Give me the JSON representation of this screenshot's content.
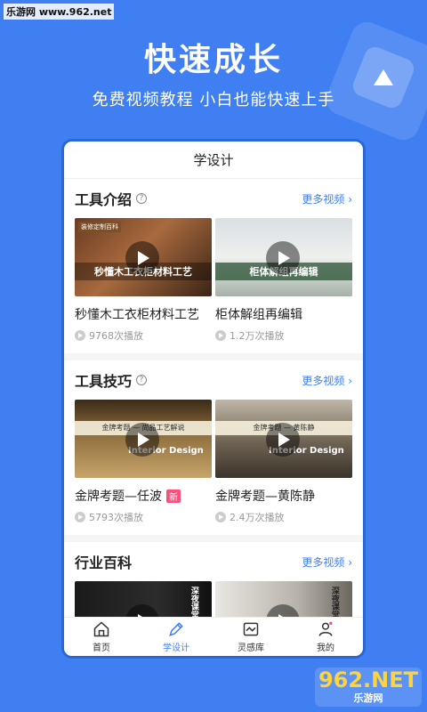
{
  "watermark_top": "乐游网 www.962.net",
  "headline": "快速成长",
  "subline": "免费视频教程 小白也能快速上手",
  "phone_title": "学设计",
  "sections": [
    {
      "title": "工具介绍",
      "help": "?",
      "more": "更多视频 ›",
      "cards": [
        {
          "title": "秒懂木工衣柜材料工艺",
          "views": "9768次播放",
          "thumb_text": "秒懂木工衣柜材料工艺",
          "tag": "装修定制百科",
          "badge": ""
        },
        {
          "title": "柜体解组再编辑",
          "views": "1.2万次播放",
          "thumb_text": "柜体解组再编辑",
          "tag": "",
          "badge": ""
        }
      ]
    },
    {
      "title": "工具技巧",
      "help": "?",
      "more": "更多视频 ›",
      "cards": [
        {
          "title": "金牌考题—任波",
          "views": "5793次播放",
          "banner": "金牌考题 — 尚品工艺解说",
          "logo": "Interior Design",
          "badge": "新"
        },
        {
          "title": "金牌考题—黄陈静",
          "views": "2.4万次播放",
          "banner": "金牌考题 — 黄陈静",
          "logo": "Interior Design",
          "badge": ""
        }
      ]
    },
    {
      "title": "行业百科",
      "help": "",
      "more": "更多视频 ›",
      "cards": [
        {
          "title": "",
          "views": "",
          "thumb_text": "深夜课堂"
        },
        {
          "title": "",
          "views": "",
          "thumb_text": "深夜课堂"
        }
      ]
    }
  ],
  "tabs": [
    {
      "label": "首页",
      "icon": "home-icon",
      "active": false
    },
    {
      "label": "学设计",
      "icon": "pencil-icon",
      "active": true
    },
    {
      "label": "灵感库",
      "icon": "inspiration-icon",
      "active": false
    },
    {
      "label": "我的",
      "icon": "user-icon",
      "active": false
    }
  ],
  "watermark_bottom": {
    "big": "962.NET",
    "small": "乐游网"
  },
  "colors": {
    "accent": "#3f7ff2",
    "badge": "#ff4d7a"
  }
}
